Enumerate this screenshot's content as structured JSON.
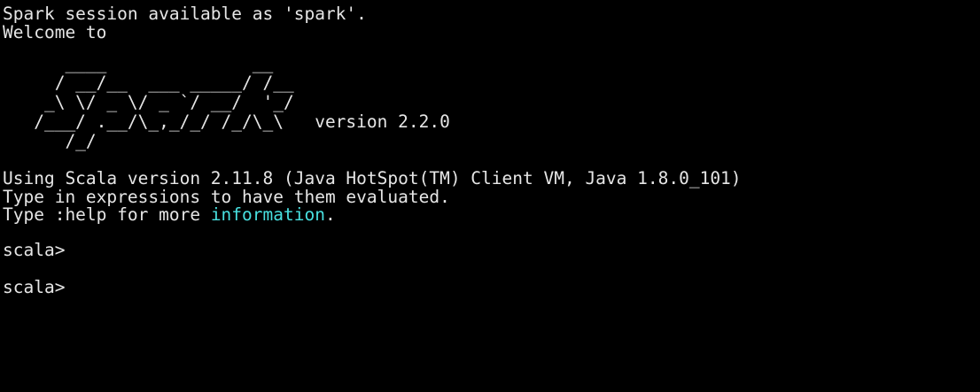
{
  "terminal": {
    "lines_top": [
      "Spark session available as 'spark'.",
      "Welcome to"
    ],
    "banner": [
      "      ____              __",
      "     / __/__  ___ _____/ /__",
      "    _\\ \\/ _ \\/ _ `/ __/  '_/",
      "   /___/ .__/\\_,_/_/ /_/\\_\\   version 2.2.0",
      "      /_/"
    ],
    "scala_info": "Using Scala version 2.11.8 (Java HotSpot(TM) Client VM, Java 1.8.0_101)",
    "eval_info": "Type in expressions to have them evaluated.",
    "help_prefix": "Type :help for more ",
    "help_highlight": "information",
    "help_suffix": ".",
    "prompts": [
      "scala>",
      "scala>"
    ],
    "colors": {
      "background": "#000000",
      "text": "#e6e6e6",
      "highlight": "#48e0e0"
    }
  }
}
